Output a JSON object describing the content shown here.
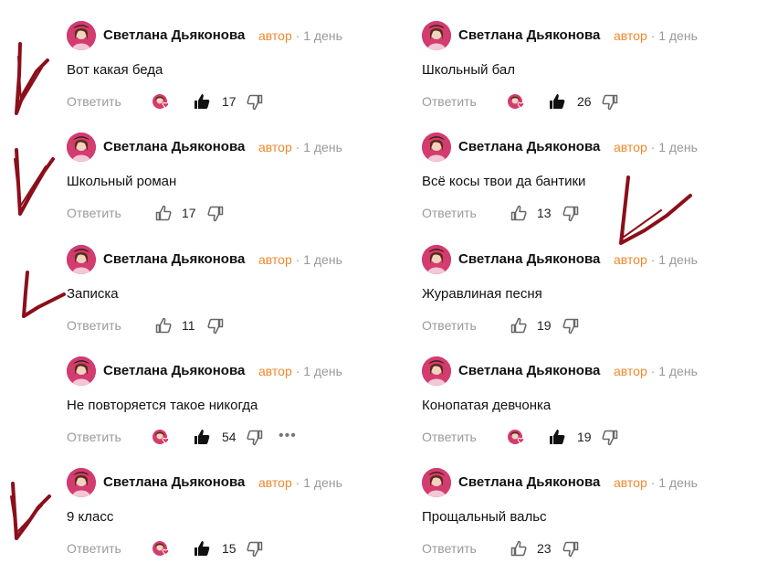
{
  "comments": [
    {
      "author": "Светлана Дьяконова",
      "role": "автор",
      "time": "1 день",
      "text": "Вот какая беда",
      "reply": "Ответить",
      "likes": "17",
      "liked": true,
      "reactor": true,
      "more": false
    },
    {
      "author": "Светлана Дьяконова",
      "role": "автор",
      "time": "1 день",
      "text": "Школьный роман",
      "reply": "Ответить",
      "likes": "17",
      "liked": false,
      "reactor": false,
      "more": false
    },
    {
      "author": "Светлана Дьяконова",
      "role": "автор",
      "time": "1 день",
      "text": "Записка",
      "reply": "Ответить",
      "likes": "11",
      "liked": false,
      "reactor": false,
      "more": false
    },
    {
      "author": "Светлана Дьяконова",
      "role": "автор",
      "time": "1 день",
      "text": "Не повторяется такое никогда",
      "reply": "Ответить",
      "likes": "54",
      "liked": true,
      "reactor": true,
      "more": true
    },
    {
      "author": "Светлана Дьяконова",
      "role": "автор",
      "time": "1 день",
      "text": "9 класс",
      "reply": "Ответить",
      "likes": "15",
      "liked": true,
      "reactor": true,
      "more": false
    },
    {
      "author": "Светлана Дьяконова",
      "role": "автор",
      "time": "1 день",
      "text": "Школьный бал",
      "reply": "Ответить",
      "likes": "26",
      "liked": true,
      "reactor": true,
      "more": false
    },
    {
      "author": "Светлана Дьяконова",
      "role": "автор",
      "time": "1 день",
      "text": "Всё косы твои да бантики",
      "reply": "Ответить",
      "likes": "13",
      "liked": false,
      "reactor": false,
      "more": false
    },
    {
      "author": "Светлана Дьяконова",
      "role": "автор",
      "time": "1 день",
      "text": "Журавлиная песня",
      "reply": "Ответить",
      "likes": "19",
      "liked": false,
      "reactor": false,
      "more": false
    },
    {
      "author": "Светлана Дьяконова",
      "role": "автор",
      "time": "1 день",
      "text": "Конопатая девчонка",
      "reply": "Ответить",
      "likes": "19",
      "liked": true,
      "reactor": true,
      "more": false
    },
    {
      "author": "Светлана Дьяконова",
      "role": "автор",
      "time": "1 день",
      "text": "Прощальный вальс",
      "reply": "Ответить",
      "likes": "23",
      "liked": false,
      "reactor": false,
      "more": false
    }
  ],
  "colors": {
    "accent": "#f0882c",
    "meta": "#999999",
    "ink": "#8b0f1a"
  }
}
